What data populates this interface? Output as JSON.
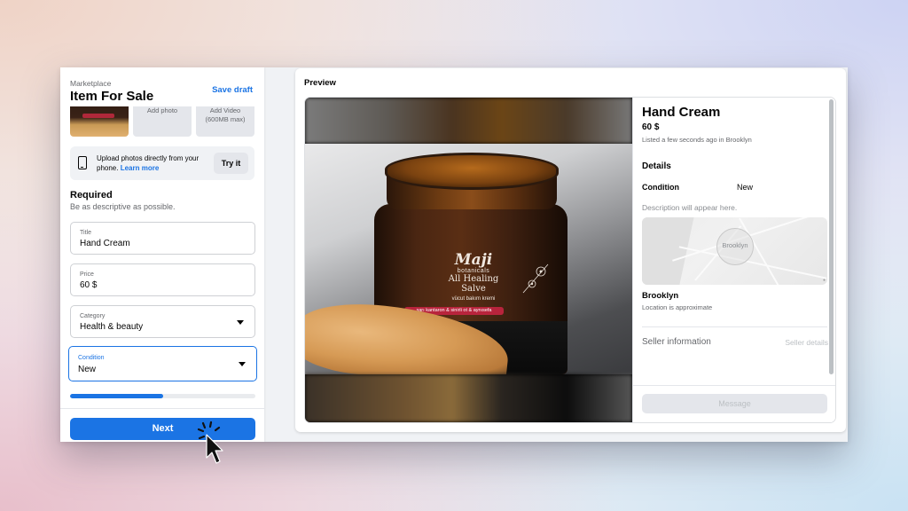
{
  "sidebar": {
    "breadcrumb": "Marketplace",
    "title": "Item For Sale",
    "save_draft": "Save draft",
    "media": {
      "add_photo": "Add photo",
      "add_video": "Add Video",
      "add_video_note": "(600MB max)"
    },
    "upload_tip": {
      "icon": "phone-icon",
      "text": "Upload photos directly from your phone.",
      "link": "Learn more",
      "button": "Try it"
    },
    "required": {
      "heading": "Required",
      "subtext": "Be as descriptive as possible."
    },
    "fields": {
      "title": {
        "label": "Title",
        "value": "Hand Cream"
      },
      "price": {
        "label": "Price",
        "value": "60 $"
      },
      "category": {
        "label": "Category",
        "value": "Health & beauty"
      },
      "condition": {
        "label": "Condition",
        "value": "New"
      }
    },
    "progress_percent": 50,
    "next_button": "Next"
  },
  "preview": {
    "label": "Preview",
    "photo_label": {
      "brand": "Maji",
      "sub_brand": "botanicals",
      "product_line1": "All Healing",
      "product_line2": "Salve",
      "subtitle": "vücut bakım kremi",
      "band": "sarı kantaron & sinirli ot & aynısefa"
    },
    "item_title": "Hand Cream",
    "price": "60 $",
    "listed": "Listed a few seconds ago in Brooklyn",
    "details_heading": "Details",
    "condition_label": "Condition",
    "condition_value": "New",
    "description_placeholder": "Description will appear here.",
    "map_label": "Brooklyn",
    "location_name": "Brooklyn",
    "location_note": "Location is approximate",
    "seller_info": "Seller information",
    "seller_details": "Seller details",
    "message_button": "Message"
  },
  "colors": {
    "accent": "#1b74e4",
    "text_primary": "#050505",
    "text_secondary": "#65676b",
    "disabled": "#e4e6eb"
  }
}
